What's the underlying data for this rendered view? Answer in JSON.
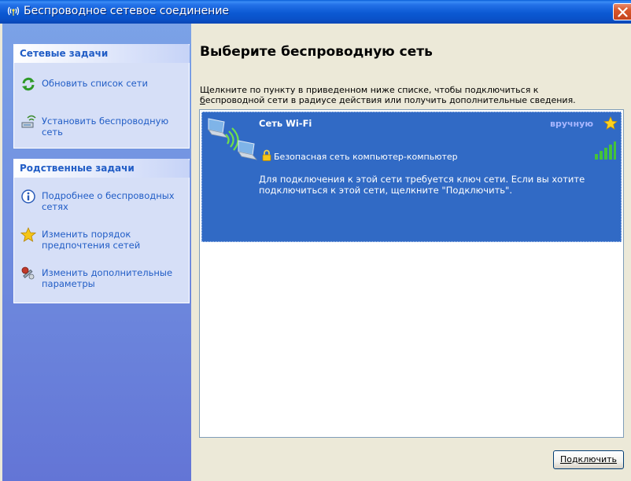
{
  "window": {
    "title": "Беспроводное сетевое соединение",
    "title_icon": "wireless-signal-icon",
    "close_icon": "close-icon"
  },
  "network_tasks": {
    "header": "Сетевые задачи",
    "items": [
      {
        "label": "Обновить список сети",
        "icon": "refresh-icon"
      },
      {
        "label": "Установить беспроводную сеть",
        "icon": "setup-wireless-icon"
      }
    ]
  },
  "related_tasks": {
    "header": "Родственные задачи",
    "items": [
      {
        "label": "Подробнее о беспроводных сетях",
        "icon": "info-icon"
      },
      {
        "label": "Изменить порядок предпочтения сетей",
        "icon": "star-icon"
      },
      {
        "label": "Изменить дополнительные параметры",
        "icon": "settings-icon"
      }
    ]
  },
  "main": {
    "heading": "Выберите беспроводную сеть",
    "instruction_line1": "Щелкните по пункту в приведенном ниже списке, чтобы подключиться к",
    "instruction_line2_u": "б",
    "instruction_line2": "еспроводной сети в радиусе действия или получить дополнительные сведения.",
    "networks": [
      {
        "name": "Сеть Wi-Fi",
        "connection_mode": "вручную",
        "security": "Безопасная сеть компьютер-компьютер",
        "description": "Для подключения к этой сети требуется ключ сети. Если вы хотите подключиться к этой сети, щелкните \"Подключить\".",
        "signal_strength": "5 of 5 bars",
        "selected": true
      }
    ],
    "connect_button": "Подключить"
  },
  "colors": {
    "titlebar": "#0a59d3",
    "left_pane": "#7ba2e7",
    "taskbox": "#d6dff7",
    "task_link": "#215dc6",
    "selection": "#316ac5",
    "manual_text": "#a9b7ff",
    "signal": "#44c23a"
  }
}
